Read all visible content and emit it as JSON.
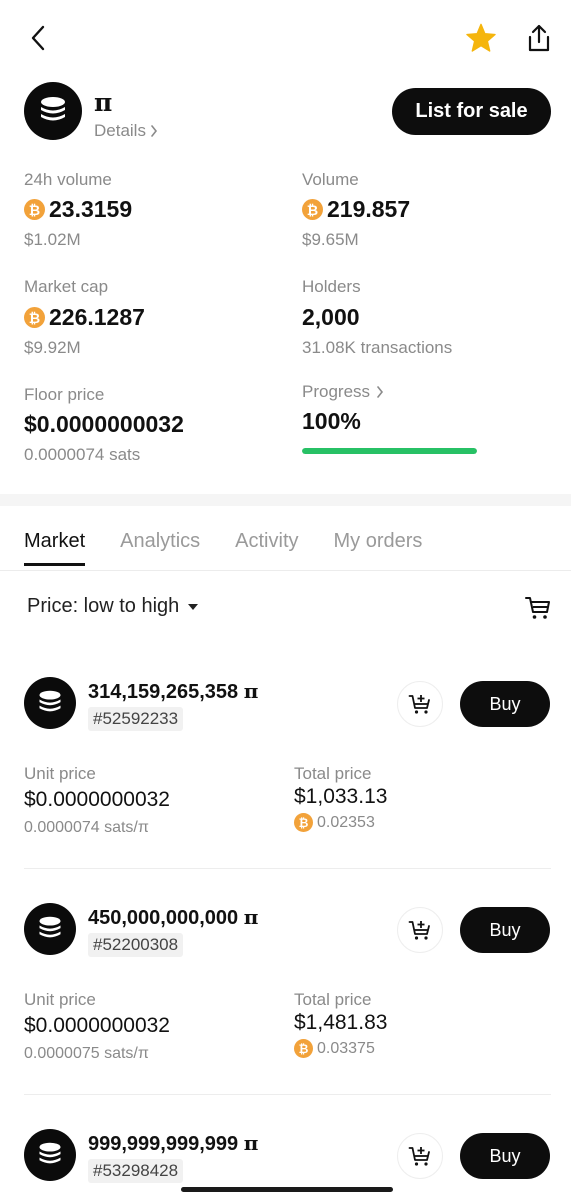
{
  "header": {
    "back_icon": "back-chevron-icon",
    "favorite_icon": "star-icon",
    "favorite_color": "#f5b50d",
    "share_icon": "share-icon"
  },
  "token": {
    "name": "π",
    "details_label": "Details",
    "list_for_sale_label": "List for sale"
  },
  "stats": {
    "volume_24h": {
      "label": "24h volume",
      "value": "23.3159",
      "usd": "$1.02M"
    },
    "volume": {
      "label": "Volume",
      "value": "219.857",
      "usd": "$9.65M"
    },
    "market_cap": {
      "label": "Market cap",
      "value": "226.1287",
      "usd": "$9.92M"
    },
    "holders": {
      "label": "Holders",
      "value": "2,000",
      "sub": "31.08K transactions"
    },
    "floor_price": {
      "label": "Floor price",
      "value": "$0.0000000032",
      "sub": "0.0000074 sats"
    },
    "progress": {
      "label": "Progress",
      "value": "100%",
      "fraction": 1.0,
      "color": "#27c165"
    }
  },
  "tabs": [
    {
      "label": "Market",
      "active": true
    },
    {
      "label": "Analytics",
      "active": false
    },
    {
      "label": "Activity",
      "active": false
    },
    {
      "label": "My orders",
      "active": false
    }
  ],
  "sort": {
    "label": "Price: low to high"
  },
  "common": {
    "unit_price_label": "Unit price",
    "total_price_label": "Total price",
    "buy_label": "Buy",
    "btc_symbol": "₿",
    "btc_color": "#f2a23a"
  },
  "listings": [
    {
      "amount": "314,159,265,358",
      "ticker": "π",
      "inscription": "#52592233",
      "unit_price": "$0.0000000032",
      "unit_sats": "0.0000074 sats/π",
      "total_price": "$1,033.13",
      "total_btc": "0.02353"
    },
    {
      "amount": "450,000,000,000",
      "ticker": "π",
      "inscription": "#52200308",
      "unit_price": "$0.0000000032",
      "unit_sats": "0.0000075 sats/π",
      "total_price": "$1,481.83",
      "total_btc": "0.03375"
    },
    {
      "amount": "999,999,999,999",
      "ticker": "π",
      "inscription": "#53298428"
    }
  ]
}
